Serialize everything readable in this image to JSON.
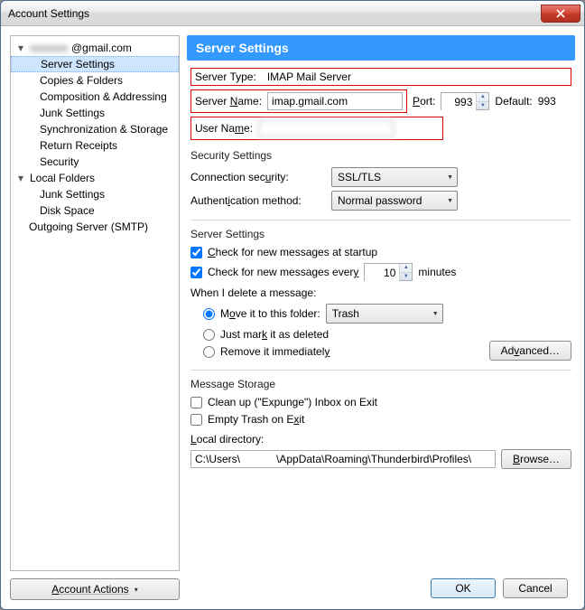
{
  "window": {
    "title": "Account Settings"
  },
  "sidebar": {
    "account_email_suffix": "@gmail.com",
    "items_account": [
      "Server Settings",
      "Copies & Folders",
      "Composition & Addressing",
      "Junk Settings",
      "Synchronization & Storage",
      "Return Receipts",
      "Security"
    ],
    "local_folders_label": "Local Folders",
    "items_local": [
      "Junk Settings",
      "Disk Space"
    ],
    "outgoing_label": "Outgoing Server (SMTP)",
    "account_actions_label": "Account Actions"
  },
  "main": {
    "header": "Server Settings",
    "server_type_label": "Server Type:",
    "server_type_value": "IMAP Mail Server",
    "server_name_label": "Server Name:",
    "server_name_value": "imap.gmail.com",
    "port_label": "Port:",
    "port_value": "993",
    "default_label": "Default:",
    "default_value": "993",
    "user_name_label": "User Name:",
    "user_name_value": "",
    "security_section": "Security Settings",
    "conn_sec_label": "Connection security:",
    "conn_sec_value": "SSL/TLS",
    "auth_label": "Authentication method:",
    "auth_value": "Normal password",
    "server_section": "Server Settings",
    "check_startup": "Check for new messages at startup",
    "check_every_prefix": "Check for new messages every",
    "check_every_value": "10",
    "check_every_suffix": "minutes",
    "when_delete": "When I delete a message:",
    "opt_move": "Move it to this folder:",
    "opt_move_target": "Trash",
    "opt_mark": "Just mark it as deleted",
    "opt_remove": "Remove it immediately",
    "advanced": "Advanced…",
    "storage_section": "Message Storage",
    "expunge": "Clean up (\"Expunge\") Inbox on Exit",
    "empty_trash": "Empty Trash on Exit",
    "local_dir_label": "Local directory:",
    "local_dir_value": "C:\\Users\\            \\AppData\\Roaming\\Thunderbird\\Profiles\\",
    "browse": "Browse…"
  },
  "buttons": {
    "ok": "OK",
    "cancel": "Cancel"
  }
}
